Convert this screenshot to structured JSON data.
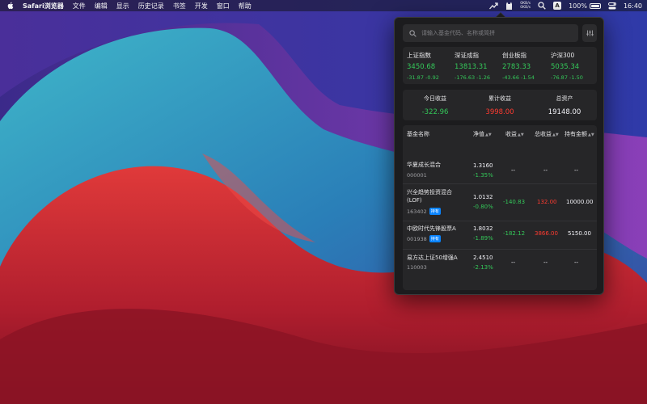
{
  "menubar": {
    "app_name": "Safari浏览器",
    "items": [
      "文件",
      "编辑",
      "显示",
      "历史记录",
      "书签",
      "开发",
      "窗口",
      "帮助"
    ],
    "net_up": "0KB/s",
    "net_down": "0KB/s",
    "input_method": "A",
    "battery_percent": "100%",
    "time": "16:40"
  },
  "search": {
    "placeholder": "请输入基金代码、名称或简拼"
  },
  "indices": [
    {
      "name": "上证指数",
      "value": "3450.68",
      "change": "-31.87",
      "percent": "-0.92"
    },
    {
      "name": "深证成指",
      "value": "13813.31",
      "change": "-176.63",
      "percent": "-1.26"
    },
    {
      "name": "创业板指",
      "value": "2783.33",
      "change": "-43.66",
      "percent": "-1.54"
    },
    {
      "name": "沪深300",
      "value": "5035.34",
      "change": "-76.87",
      "percent": "-1.50"
    }
  ],
  "summary": {
    "today_label": "今日收益",
    "today_value": "-322.96",
    "total_label": "累计收益",
    "total_value": "3998.00",
    "assets_label": "总资产",
    "assets_value": "19148.00"
  },
  "table": {
    "headers": {
      "name": "基金名称",
      "nav": "净值",
      "income": "收益",
      "total": "总收益",
      "holding": "持有金额"
    },
    "rows": [
      {
        "name": "华夏成长混合",
        "code": "000001",
        "nav": "1.3160",
        "pct": "-1.35%",
        "income": "--",
        "total": "--",
        "holding": "--",
        "held": false
      },
      {
        "name": "兴全趋势投资混合(LOF)",
        "code": "163402",
        "nav": "1.0132",
        "pct": "-0.80%",
        "income": "-140.83",
        "total": "132.00",
        "holding": "10000.00",
        "held": true,
        "badge": "持有"
      },
      {
        "name": "中欧时代先锋股票A",
        "code": "001938",
        "nav": "1.8032",
        "pct": "-1.89%",
        "income": "-182.12",
        "total": "3866.00",
        "holding": "5150.00",
        "held": true,
        "badge": "持有"
      },
      {
        "name": "易方达上证50增强A",
        "code": "110003",
        "nav": "2.4510",
        "pct": "-2.13%",
        "income": "--",
        "total": "--",
        "holding": "--",
        "held": false
      }
    ]
  }
}
